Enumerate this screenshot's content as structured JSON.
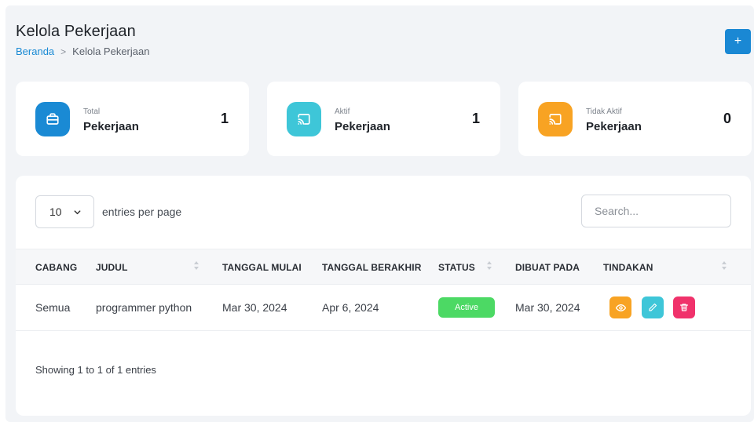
{
  "header": {
    "title": "Kelola Pekerjaan",
    "breadcrumb": {
      "home": "Beranda",
      "separator": ">",
      "current": "Kelola Pekerjaan"
    },
    "add_label": "+"
  },
  "cards": [
    {
      "label": "Total",
      "name": "Pekerjaan",
      "value": "1",
      "color": "#1a8ad4",
      "icon": "briefcase-icon"
    },
    {
      "label": "Aktif",
      "name": "Pekerjaan",
      "value": "1",
      "color": "#3ec6d8",
      "icon": "cast-icon"
    },
    {
      "label": "Tidak Aktif",
      "name": "Pekerjaan",
      "value": "0",
      "color": "#f8a323",
      "icon": "cast-icon"
    }
  ],
  "table": {
    "per_page": {
      "value": "10",
      "label": "entries per page"
    },
    "search_placeholder": "Search...",
    "columns": [
      "CABANG",
      "JUDUL",
      "TANGGAL MULAI",
      "TANGGAL BERAKHIR",
      "STATUS",
      "DIBUAT PADA",
      "TINDAKAN"
    ],
    "rows": [
      {
        "cabang": "Semua",
        "judul": "programmer python",
        "mulai": "Mar 30, 2024",
        "berakhir": "Apr 6, 2024",
        "status": "Active",
        "dibuat": "Mar 30, 2024",
        "actions": [
          {
            "icon": "eye-icon",
            "color": "#f8a323"
          },
          {
            "icon": "pencil-icon",
            "color": "#3ec6d8"
          },
          {
            "icon": "trash-icon",
            "color": "#f0326b"
          }
        ]
      }
    ],
    "info": "Showing 1 to 1 of 1 entries"
  },
  "colors": {
    "primary": "#1a88d4",
    "success": "#4cd964",
    "page_bg": "#f2f4f7"
  }
}
